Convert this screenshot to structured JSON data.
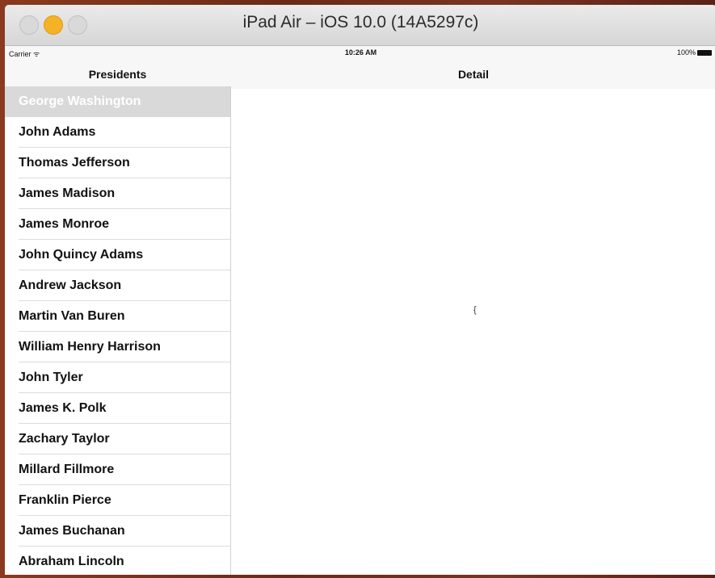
{
  "window": {
    "title": "iPad Air – iOS 10.0 (14A5297c)"
  },
  "status_bar": {
    "carrier": "Carrier ᯤ",
    "time": "10:26 AM",
    "battery": "100%"
  },
  "master": {
    "title": "Presidents",
    "selected_index": 0,
    "items": [
      {
        "label": "George Washington"
      },
      {
        "label": "John Adams"
      },
      {
        "label": "Thomas Jefferson"
      },
      {
        "label": "James Madison"
      },
      {
        "label": "James Monroe"
      },
      {
        "label": "John Quincy Adams"
      },
      {
        "label": "Andrew Jackson"
      },
      {
        "label": "Martin Van Buren"
      },
      {
        "label": "William Henry Harrison"
      },
      {
        "label": "John Tyler"
      },
      {
        "label": "James K. Polk"
      },
      {
        "label": "Zachary Taylor"
      },
      {
        "label": "Millard Fillmore"
      },
      {
        "label": "Franklin Pierce"
      },
      {
        "label": "James Buchanan"
      },
      {
        "label": "Abraham Lincoln"
      }
    ]
  },
  "detail": {
    "title": "Detail",
    "text": "{"
  },
  "colors": {
    "traffic_minimize": "#f5b224",
    "selected_row": "#d9d9d9"
  }
}
